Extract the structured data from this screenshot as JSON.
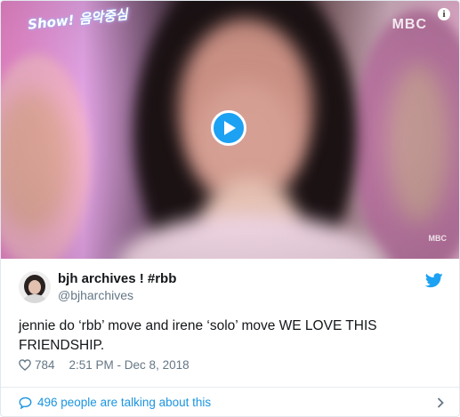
{
  "video": {
    "show_logo": "Show! 음악중심",
    "channel_logo": "MBC",
    "channel_logo_small": "MBC",
    "info_icon": "info-icon",
    "play_icon": "play-icon"
  },
  "tweet": {
    "display_name": "bjh archives ! #rbb",
    "handle": "@bjharchives",
    "text": "jennie do ‘rbb’ move and irene ‘solo’ move WE LOVE THIS FRIENDSHIP.",
    "likes": "784",
    "timestamp": "2:51 PM - Dec 8, 2018",
    "talking": "496 people are talking about this"
  },
  "icons": {
    "brand": "twitter-bird-icon",
    "like": "heart-icon",
    "reply": "speech-bubble-icon",
    "more": "chevron-right-icon"
  },
  "colors": {
    "accent": "#1da1f2",
    "link": "#1b95e0",
    "muted": "#657786",
    "text": "#14171a"
  }
}
